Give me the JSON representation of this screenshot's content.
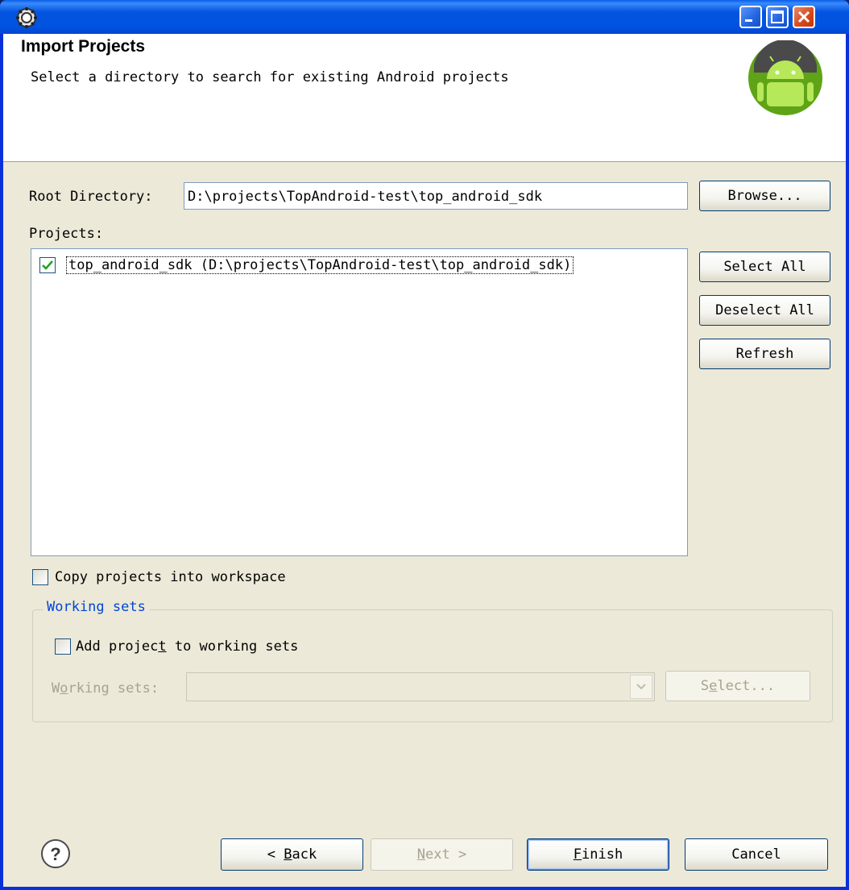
{
  "header": {
    "title": "Import Projects",
    "description": "Select a directory to search for existing Android projects"
  },
  "root_directory": {
    "label": "Root Directory:",
    "value": "D:\\projects\\TopAndroid-test\\top_android_sdk",
    "browse_label": "Browse..."
  },
  "projects": {
    "label": "Projects:",
    "items": [
      {
        "label": "top_android_sdk (D:\\projects\\TopAndroid-test\\top_android_sdk)",
        "checked": true
      }
    ],
    "select_all_label": "Select All",
    "deselect_all_label": "Deselect All",
    "refresh_label": "Refresh"
  },
  "copy_option": {
    "label": "Copy projects into workspace",
    "checked": false
  },
  "working_sets": {
    "group_label": "Working sets",
    "add_label_pre": "Add projec",
    "add_label_key": "t",
    "add_label_post": " to working sets",
    "add_checked": false,
    "field_label_pre": "W",
    "field_label_key": "o",
    "field_label_post": "rking sets:",
    "select_pre": "S",
    "select_key": "e",
    "select_post": "lect..."
  },
  "footer": {
    "back_arrow": "<",
    "back_key": "B",
    "back_rest": "ack",
    "next_key": "N",
    "next_rest": "ext",
    "next_arrow": ">",
    "finish_key": "F",
    "finish_rest": "inish",
    "cancel_label": "Cancel"
  },
  "colors": {
    "accent": "#0046d5",
    "titlebar": "#0355e0"
  }
}
